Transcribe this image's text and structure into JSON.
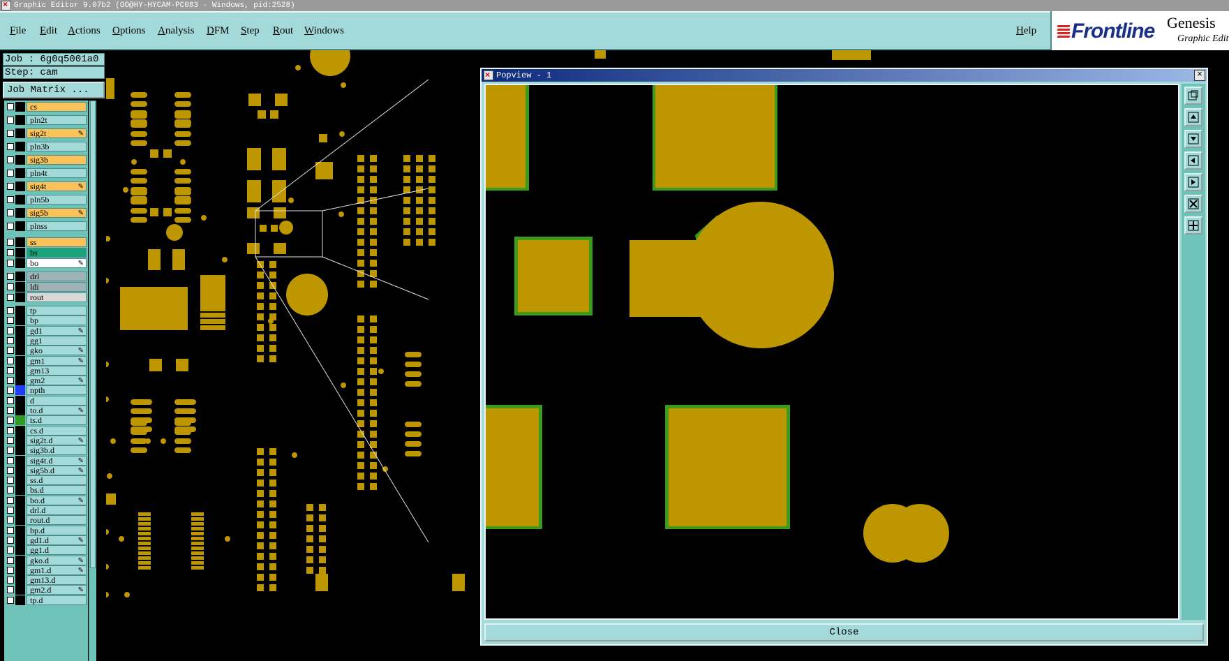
{
  "window": {
    "title": "Graphic Editor 9.07b2 (OO@HY-HYCAM-PC083 - Windows, pid:2528)"
  },
  "menu": {
    "items": [
      "File",
      "Edit",
      "Actions",
      "Options",
      "Analysis",
      "DFM",
      "Step",
      "Rout",
      "Windows"
    ],
    "help": "Help"
  },
  "logo": {
    "brand": "Frontline",
    "product": "Genesis",
    "subtitle": "Graphic Editor"
  },
  "job": {
    "job_label": "Job : 6g0q5001a0",
    "step_label": "Step: cam",
    "matrix_button": "Job Matrix ..."
  },
  "layers": [
    {
      "name": "cs",
      "color": "#f9c35a",
      "edit": false
    },
    {
      "name": "pln2t",
      "color": "#a3d9d8",
      "edit": false
    },
    {
      "name": "sig2t",
      "color": "#f9c35a",
      "edit": true
    },
    {
      "name": "pln3b",
      "color": "#a3d9d8",
      "edit": false
    },
    {
      "name": "sig3b",
      "color": "#f9c35a",
      "edit": false
    },
    {
      "name": "pln4t",
      "color": "#a3d9d8",
      "edit": false
    },
    {
      "name": "sig4t",
      "color": "#f9c35a",
      "edit": true
    },
    {
      "name": "pln5b",
      "color": "#a3d9d8",
      "edit": false
    },
    {
      "name": "sig5b",
      "color": "#f9c35a",
      "edit": true
    },
    {
      "name": "plnss",
      "color": "#a3d9d8",
      "edit": false
    },
    {
      "name": "ss",
      "color": "#f9c35a",
      "edit": false
    },
    {
      "name": "bs",
      "color": "#1aa37a",
      "edit": false
    },
    {
      "name": "bo",
      "color": "#ffffff",
      "edit": true
    },
    {
      "name": "drl",
      "color": "#9fb2b6",
      "edit": false
    },
    {
      "name": "ldi",
      "color": "#9fb2b6",
      "edit": false
    },
    {
      "name": "rout",
      "color": "#d8d8d8",
      "edit": false
    },
    {
      "name": "tp",
      "color": "#a3d9d8",
      "edit": false
    },
    {
      "name": "bp",
      "color": "#a3d9d8",
      "edit": false
    },
    {
      "name": "gd1",
      "color": "#a3d9d8",
      "edit": true
    },
    {
      "name": "gg1",
      "color": "#a3d9d8",
      "edit": false
    },
    {
      "name": "gko",
      "color": "#a3d9d8",
      "edit": true
    },
    {
      "name": "gm1",
      "color": "#a3d9d8",
      "edit": true
    },
    {
      "name": "gm13",
      "color": "#a3d9d8",
      "edit": false
    },
    {
      "name": "gm2",
      "color": "#a3d9d8",
      "edit": true
    },
    {
      "name": "npth",
      "color": "#a3d9d8",
      "edit": false,
      "swatch": "#1f3cff"
    },
    {
      "name": "d",
      "color": "#a3d9d8",
      "edit": false
    },
    {
      "name": "to.d",
      "color": "#a3d9d8",
      "edit": true
    },
    {
      "name": "ts.d",
      "color": "#a3d9d8",
      "edit": false,
      "swatch": "#2f9a1f"
    },
    {
      "name": "cs.d",
      "color": "#a3d9d8",
      "edit": false
    },
    {
      "name": "sig2t.d",
      "color": "#a3d9d8",
      "edit": true
    },
    {
      "name": "sig3b.d",
      "color": "#a3d9d8",
      "edit": false
    },
    {
      "name": "sig4t.d",
      "color": "#a3d9d8",
      "edit": true
    },
    {
      "name": "sig5b.d",
      "color": "#a3d9d8",
      "edit": true
    },
    {
      "name": "ss.d",
      "color": "#a3d9d8",
      "edit": false
    },
    {
      "name": "bs.d",
      "color": "#a3d9d8",
      "edit": false
    },
    {
      "name": "bo.d",
      "color": "#a3d9d8",
      "edit": true
    },
    {
      "name": "drl.d",
      "color": "#a3d9d8",
      "edit": false
    },
    {
      "name": "rout.d",
      "color": "#a3d9d8",
      "edit": false
    },
    {
      "name": "bp.d",
      "color": "#a3d9d8",
      "edit": false
    },
    {
      "name": "gd1.d",
      "color": "#a3d9d8",
      "edit": true
    },
    {
      "name": "gg1.d",
      "color": "#a3d9d8",
      "edit": false
    },
    {
      "name": "gko.d",
      "color": "#a3d9d8",
      "edit": true
    },
    {
      "name": "gm1.d",
      "color": "#a3d9d8",
      "edit": true
    },
    {
      "name": "gm13.d",
      "color": "#a3d9d8",
      "edit": false
    },
    {
      "name": "gm2.d",
      "color": "#a3d9d8",
      "edit": true
    },
    {
      "name": "tp.d",
      "color": "#a3d9d8",
      "edit": false
    }
  ],
  "popview": {
    "title": "Popview - 1",
    "close_button": "Close"
  },
  "colors": {
    "pad": "#be9600",
    "soldermask": "#3c9a1c",
    "panel": "#a3d9d8",
    "background": "#000000"
  }
}
